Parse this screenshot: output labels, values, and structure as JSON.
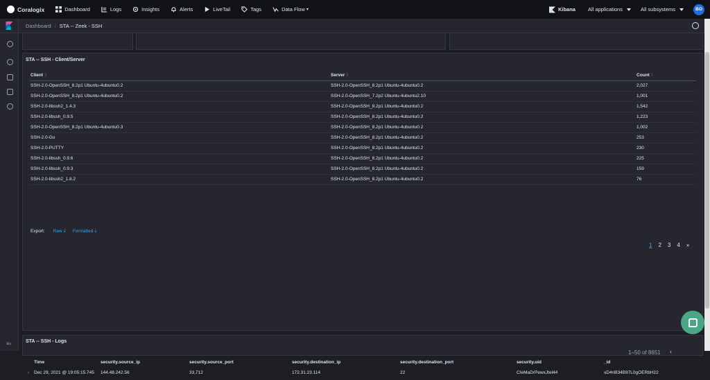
{
  "topbar": {
    "brand": "Coralogix",
    "nav": [
      {
        "label": "Dashboard",
        "icon": "grid-icon"
      },
      {
        "label": "Logs",
        "icon": "logs-icon"
      },
      {
        "label": "Insights",
        "icon": "gear-icon"
      },
      {
        "label": "Alerts",
        "icon": "bell-icon"
      },
      {
        "label": "LiveTail",
        "icon": "play-icon"
      },
      {
        "label": "Tags",
        "icon": "tag-icon"
      },
      {
        "label": "Data Flow",
        "icon": "dataflow-icon"
      }
    ],
    "kibana": "Kibana",
    "applications": "All applications",
    "subsystems": "All subsystems",
    "avatar": "BO"
  },
  "breadcrumb": {
    "parent": "Dashboard",
    "current": "STA -- Zeek - SSH"
  },
  "panel": {
    "title": "STA -- SSH - Client/Server",
    "columns": [
      "Client",
      "Server",
      "Count"
    ],
    "rows": [
      [
        "SSH-2.0-OpenSSH_8.2p1 Ubuntu-4ubuntu0.2",
        "SSH-2.0-OpenSSH_8.2p1 Ubuntu-4ubuntu0.2",
        "2,027"
      ],
      [
        "SSH-2.0-OpenSSH_8.2p1 Ubuntu-4ubuntu0.2",
        "SSH-2.0-OpenSSH_7.2p2 Ubuntu-4ubuntu2.10",
        "1,001"
      ],
      [
        "SSH-2.0-libssh2_1.4.3",
        "SSH-2.0-OpenSSH_8.2p1 Ubuntu-4ubuntu0.2",
        "1,542"
      ],
      [
        "SSH-2.0-libssh_0.9.5",
        "SSH-2.0-OpenSSH_8.2p1 Ubuntu-4ubuntu0.2",
        "1,223"
      ],
      [
        "SSH-2.0-OpenSSH_8.2p1 Ubuntu-4ubuntu0.3",
        "SSH-2.0-OpenSSH_8.2p1 Ubuntu-4ubuntu0.2",
        "1,002"
      ],
      [
        "SSH-2.0-Go",
        "SSH-2.0-OpenSSH_8.2p1 Ubuntu-4ubuntu0.2",
        "253"
      ],
      [
        "SSH-2.0-PUTTY",
        "SSH-2.0-OpenSSH_8.2p1 Ubuntu-4ubuntu0.2",
        "230"
      ],
      [
        "SSH-2.0-libssh_0.9.6",
        "SSH-2.0-OpenSSH_8.2p1 Ubuntu-4ubuntu0.2",
        "225"
      ],
      [
        "SSH-2.0-libssh_0.9.3",
        "SSH-2.0-OpenSSH_8.2p1 Ubuntu-4ubuntu0.2",
        "159"
      ],
      [
        "SSH-2.0-libssh2_1.8.2",
        "SSH-2.0-OpenSSH_8.2p1 Ubuntu-4ubuntu0.2",
        "76"
      ]
    ],
    "export_label": "Export:",
    "export_raw": "Raw",
    "export_formatted": "Formatted",
    "pages": [
      "1",
      "2",
      "3",
      "4",
      "»"
    ]
  },
  "logs": {
    "title": "STA -- SSH - Logs",
    "count": "1–50 of 8651",
    "columns": [
      "Time",
      "security.source_ip",
      "security.source_port",
      "security.destination_ip",
      "security.destination_port",
      "security.uid",
      "_id"
    ],
    "row": [
      "Dec 29, 2021 @ 19:05:15.745",
      "144.48.242.56",
      "33,712",
      "172.31.23.114",
      "22",
      "CIeMaDrPewxJtel44",
      "sD4nB34B97L0gOERbH22"
    ]
  }
}
